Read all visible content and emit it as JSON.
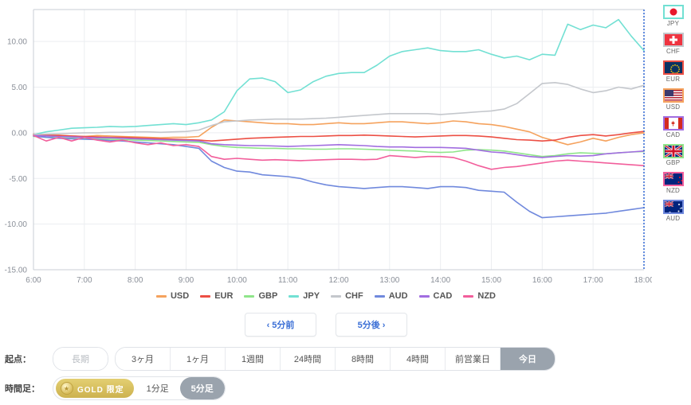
{
  "chart_data": {
    "type": "line",
    "title": "",
    "xlabel": "",
    "ylabel": "",
    "xlim": [
      6,
      18
    ],
    "ylim": [
      -15,
      13.5
    ],
    "grid": true,
    "legend_position": "bottom",
    "x_ticks": [
      "6:00",
      "7:00",
      "8:00",
      "9:00",
      "10:00",
      "11:00",
      "12:00",
      "13:00",
      "14:00",
      "15:00",
      "16:00",
      "17:00",
      "18:00"
    ],
    "y_ticks": [
      "10.00",
      "5.00",
      "0.00",
      "-5.00",
      "-10.00",
      "-15.00"
    ],
    "y_tick_values": [
      10,
      5,
      0,
      -5,
      -10,
      -15
    ],
    "x": [
      6.0,
      6.25,
      6.5,
      6.75,
      7.0,
      7.25,
      7.5,
      7.75,
      8.0,
      8.25,
      8.5,
      8.75,
      9.0,
      9.25,
      9.5,
      9.75,
      10.0,
      10.25,
      10.5,
      10.75,
      11.0,
      11.25,
      11.5,
      11.75,
      12.0,
      12.25,
      12.5,
      12.75,
      13.0,
      13.25,
      13.5,
      13.75,
      14.0,
      14.25,
      14.5,
      14.75,
      15.0,
      15.25,
      15.5,
      15.75,
      16.0,
      16.25,
      16.5,
      16.75,
      17.0,
      17.25,
      17.5,
      17.75,
      18.0
    ],
    "series": [
      {
        "name": "USD",
        "color": "#f5a25d",
        "values": [
          -0.2,
          -0.3,
          -0.25,
          -0.35,
          -0.4,
          -0.3,
          -0.35,
          -0.4,
          -0.45,
          -0.5,
          -0.55,
          -0.5,
          -0.5,
          -0.4,
          0.6,
          1.4,
          1.3,
          1.2,
          1.1,
          1.0,
          1.0,
          0.9,
          0.9,
          1.0,
          1.1,
          1.0,
          1.0,
          1.1,
          1.2,
          1.2,
          1.1,
          1.0,
          1.1,
          1.3,
          1.2,
          1.0,
          0.9,
          0.7,
          0.4,
          0.1,
          -0.5,
          -0.9,
          -1.3,
          -1.0,
          -0.6,
          -0.9,
          -0.5,
          -0.2,
          0.0
        ]
      },
      {
        "name": "EUR",
        "color": "#ec4f44",
        "values": [
          -0.15,
          -0.25,
          -0.3,
          -0.35,
          -0.4,
          -0.45,
          -0.5,
          -0.5,
          -0.55,
          -0.6,
          -0.65,
          -0.7,
          -0.75,
          -0.8,
          -0.9,
          -0.8,
          -0.7,
          -0.6,
          -0.55,
          -0.5,
          -0.45,
          -0.4,
          -0.4,
          -0.35,
          -0.3,
          -0.3,
          -0.25,
          -0.3,
          -0.35,
          -0.4,
          -0.45,
          -0.4,
          -0.35,
          -0.3,
          -0.3,
          -0.35,
          -0.45,
          -0.6,
          -0.75,
          -0.8,
          -0.9,
          -0.8,
          -0.5,
          -0.3,
          -0.2,
          -0.35,
          -0.2,
          0.0,
          0.15
        ]
      },
      {
        "name": "GBP",
        "color": "#8fe58a",
        "values": [
          -0.4,
          -0.5,
          -0.55,
          -0.6,
          -0.65,
          -0.7,
          -0.7,
          -0.75,
          -0.8,
          -0.85,
          -0.9,
          -0.95,
          -1.0,
          -1.05,
          -1.3,
          -1.5,
          -1.6,
          -1.65,
          -1.7,
          -1.7,
          -1.75,
          -1.75,
          -1.8,
          -1.8,
          -1.75,
          -1.75,
          -1.8,
          -1.85,
          -1.9,
          -1.95,
          -2.0,
          -2.1,
          -2.15,
          -2.1,
          -1.9,
          -1.85,
          -1.9,
          -2.0,
          -2.2,
          -2.4,
          -2.6,
          -2.5,
          -2.3,
          -2.2,
          -2.25,
          -2.3,
          -2.2,
          -2.1,
          -2.05
        ]
      },
      {
        "name": "JPY",
        "color": "#72e0d3",
        "values": [
          -0.2,
          0.1,
          0.3,
          0.5,
          0.55,
          0.6,
          0.7,
          0.65,
          0.7,
          0.8,
          0.9,
          1.0,
          0.9,
          1.1,
          1.4,
          2.3,
          4.6,
          5.9,
          6.0,
          5.6,
          4.4,
          4.7,
          5.6,
          6.2,
          6.5,
          6.6,
          6.6,
          7.4,
          8.4,
          8.9,
          9.1,
          9.3,
          9.0,
          8.9,
          8.9,
          9.1,
          8.6,
          8.2,
          8.4,
          8.0,
          8.6,
          8.5,
          11.9,
          11.3,
          11.8,
          11.5,
          12.4,
          10.6,
          9.0
        ]
      },
      {
        "name": "CHF",
        "color": "#c4c7cc",
        "values": [
          -0.2,
          -0.15,
          -0.1,
          -0.05,
          0.0,
          0.0,
          0.05,
          0.05,
          0.1,
          0.1,
          0.05,
          0.1,
          0.15,
          0.3,
          0.8,
          1.2,
          1.3,
          1.4,
          1.45,
          1.5,
          1.5,
          1.5,
          1.55,
          1.6,
          1.7,
          1.8,
          1.9,
          2.0,
          2.1,
          2.1,
          2.1,
          2.1,
          2.0,
          2.1,
          2.2,
          2.3,
          2.4,
          2.6,
          3.2,
          4.3,
          5.4,
          5.5,
          5.3,
          4.8,
          4.4,
          4.6,
          5.0,
          4.8,
          5.2
        ]
      },
      {
        "name": "AUD",
        "color": "#7089dd",
        "values": [
          -0.35,
          -0.5,
          -0.6,
          -0.65,
          -0.7,
          -0.75,
          -0.85,
          -0.9,
          -1.0,
          -1.1,
          -1.2,
          -1.3,
          -1.5,
          -1.7,
          -3.1,
          -3.8,
          -4.2,
          -4.3,
          -4.6,
          -4.7,
          -4.8,
          -5.0,
          -5.4,
          -5.7,
          -5.9,
          -6.0,
          -6.1,
          -6.0,
          -5.9,
          -5.9,
          -6.0,
          -6.1,
          -5.9,
          -5.9,
          -6.0,
          -6.3,
          -6.4,
          -6.5,
          -7.6,
          -8.6,
          -9.3,
          -9.2,
          -9.1,
          -9.0,
          -8.9,
          -8.8,
          -8.6,
          -8.4,
          -8.2
        ]
      },
      {
        "name": "CAD",
        "color": "#a16de0",
        "values": [
          -0.3,
          -0.35,
          -0.4,
          -0.45,
          -0.5,
          -0.55,
          -0.55,
          -0.6,
          -0.65,
          -0.7,
          -0.75,
          -0.8,
          -0.85,
          -0.9,
          -1.2,
          -1.3,
          -1.35,
          -1.4,
          -1.4,
          -1.45,
          -1.5,
          -1.45,
          -1.4,
          -1.35,
          -1.3,
          -1.35,
          -1.4,
          -1.5,
          -1.55,
          -1.55,
          -1.6,
          -1.6,
          -1.6,
          -1.65,
          -1.7,
          -1.9,
          -2.1,
          -2.2,
          -2.4,
          -2.6,
          -2.7,
          -2.6,
          -2.5,
          -2.55,
          -2.5,
          -2.3,
          -2.2,
          -2.1,
          -2.0
        ]
      },
      {
        "name": "NZD",
        "color": "#f25e9b",
        "values": [
          -0.3,
          -0.9,
          -0.5,
          -0.9,
          -0.5,
          -0.8,
          -1.0,
          -0.8,
          -1.1,
          -1.3,
          -1.1,
          -1.4,
          -1.3,
          -1.5,
          -2.6,
          -2.9,
          -2.8,
          -2.9,
          -3.0,
          -2.95,
          -3.0,
          -3.05,
          -3.0,
          -2.95,
          -2.9,
          -2.9,
          -2.95,
          -2.9,
          -2.5,
          -2.6,
          -2.7,
          -2.6,
          -2.6,
          -2.7,
          -3.1,
          -3.6,
          -4.0,
          -3.8,
          -3.7,
          -3.5,
          -3.3,
          -3.1,
          -3.0,
          -3.1,
          -3.2,
          -3.3,
          -3.4,
          -3.5,
          -3.6
        ]
      }
    ]
  },
  "legend": {
    "items": [
      {
        "label": "USD",
        "color": "#f5a25d"
      },
      {
        "label": "EUR",
        "color": "#ec4f44"
      },
      {
        "label": "GBP",
        "color": "#8fe58a"
      },
      {
        "label": "JPY",
        "color": "#72e0d3"
      },
      {
        "label": "CHF",
        "color": "#c4c7cc"
      },
      {
        "label": "AUD",
        "color": "#7089dd"
      },
      {
        "label": "CAD",
        "color": "#a16de0"
      },
      {
        "label": "NZD",
        "color": "#f25e9b"
      }
    ]
  },
  "flags": {
    "items": [
      {
        "label": "JPY",
        "border": "#72e0d3",
        "icon": "flag-jpy-icon"
      },
      {
        "label": "CHF",
        "border": "#c4c7cc",
        "icon": "flag-chf-icon"
      },
      {
        "label": "EUR",
        "border": "#ec4f44",
        "icon": "flag-eur-icon"
      },
      {
        "label": "USD",
        "border": "#f5a25d",
        "icon": "flag-usd-icon"
      },
      {
        "label": "CAD",
        "border": "#a16de0",
        "icon": "flag-cad-icon"
      },
      {
        "label": "GBP",
        "border": "#8fe58a",
        "icon": "flag-gbp-icon"
      },
      {
        "label": "NZD",
        "border": "#f25e9b",
        "icon": "flag-nzd-icon"
      },
      {
        "label": "AUD",
        "border": "#7089dd",
        "icon": "flag-aud-icon"
      }
    ]
  },
  "nav": {
    "prev_label": "‹ 5分前",
    "next_label": "5分後 ›"
  },
  "origin_row": {
    "label": "起点：",
    "long_term": "長期",
    "options": [
      "3ヶ月",
      "1ヶ月",
      "1週間",
      "24時間",
      "8時間",
      "4時間",
      "前営業日",
      "今日"
    ],
    "active": "今日"
  },
  "timeframe_row": {
    "label": "時間足：",
    "gold_badge": "GOLD 限定",
    "options": [
      "1分足",
      "5分足"
    ],
    "active": "5分足"
  },
  "colors": {
    "accent_blue": "#3b6fd6",
    "active_gray": "#9aa3ad",
    "grid": "#eceef1"
  }
}
